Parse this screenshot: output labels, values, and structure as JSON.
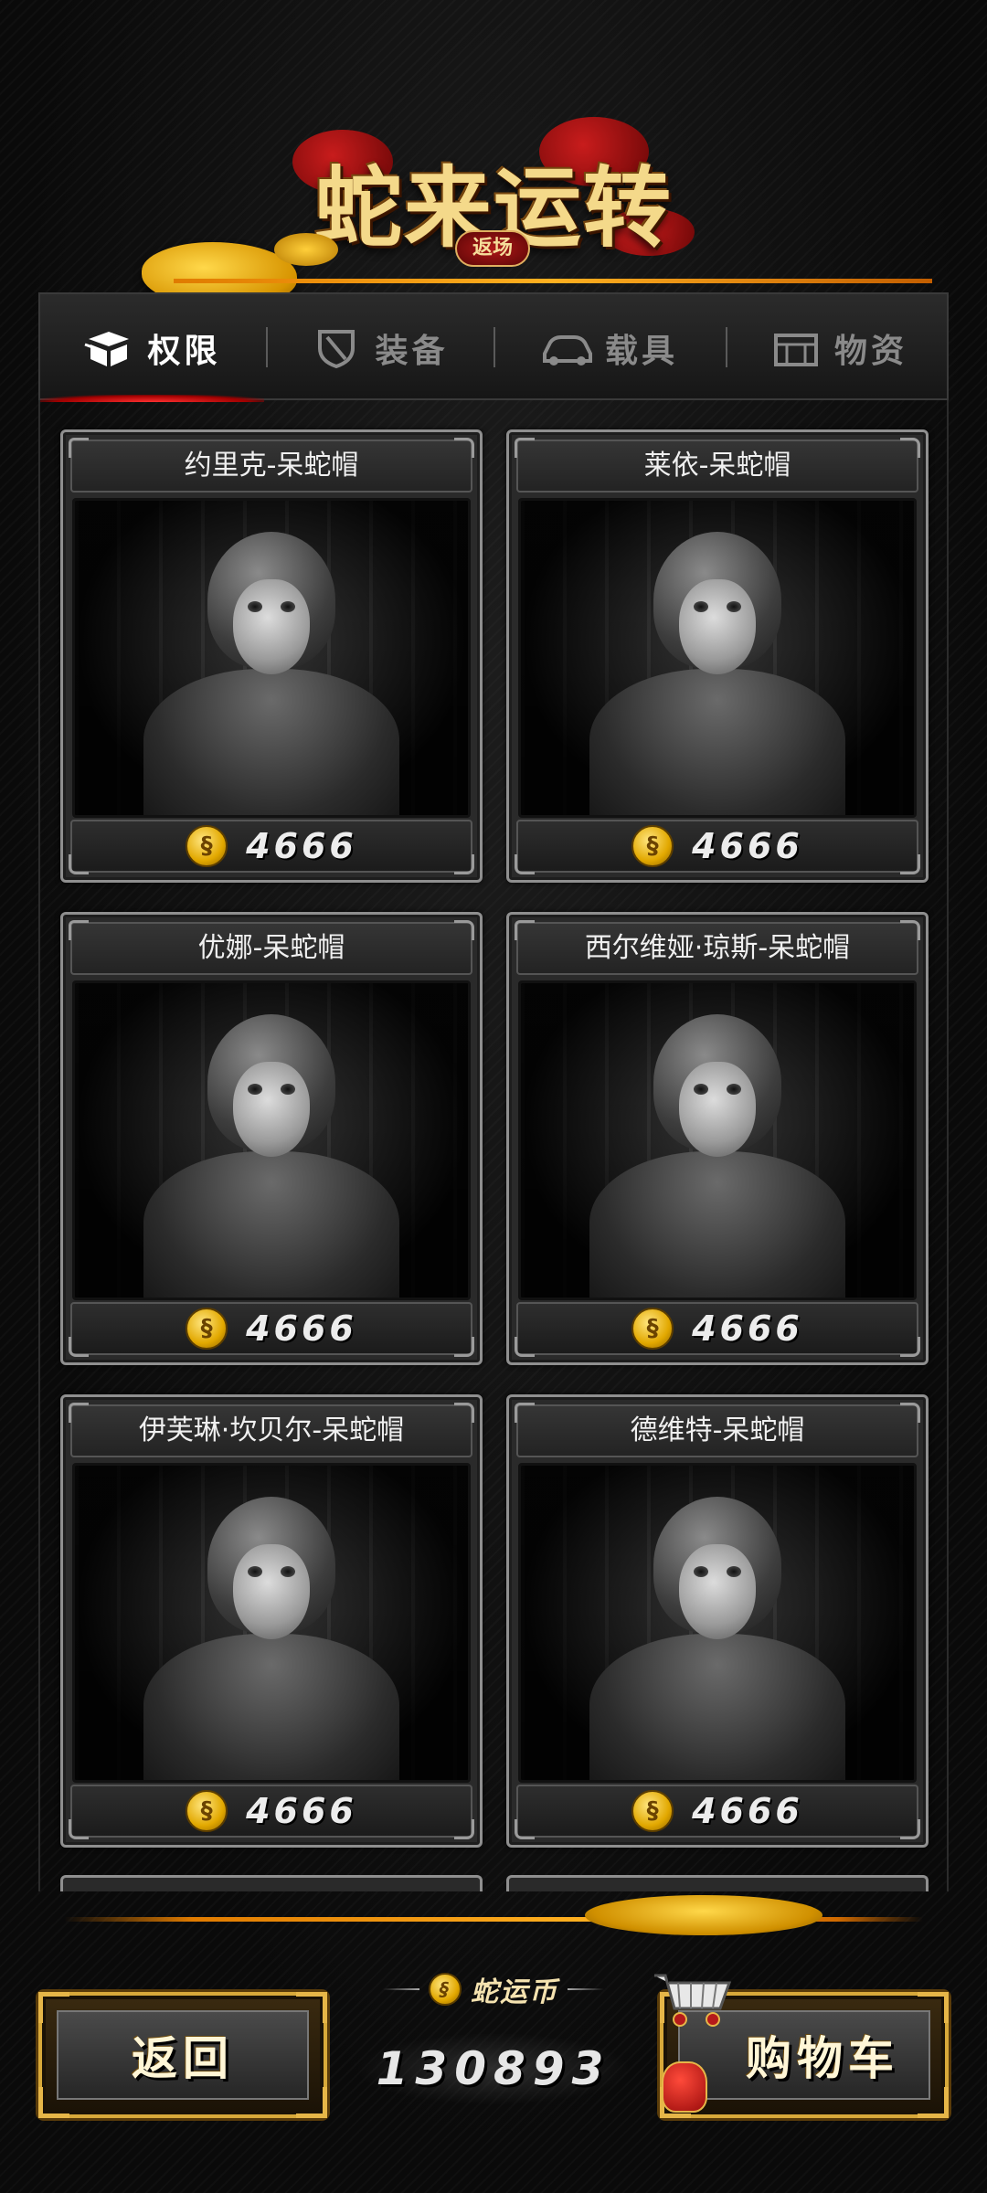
{
  "header": {
    "title": "蛇来运转",
    "subtitle": "返场"
  },
  "tabs": [
    {
      "label": "权限",
      "icon": "box-icon",
      "active": true
    },
    {
      "label": "装备",
      "icon": "shield-icon",
      "active": false
    },
    {
      "label": "载具",
      "icon": "car-icon",
      "active": false
    },
    {
      "label": "物资",
      "icon": "crate-icon",
      "active": false
    }
  ],
  "items": [
    {
      "name": "约里克-呆蛇帽",
      "price": "4666"
    },
    {
      "name": "莱依-呆蛇帽",
      "price": "4666"
    },
    {
      "name": "优娜-呆蛇帽",
      "price": "4666"
    },
    {
      "name": "西尔维娅·琼斯-呆蛇帽",
      "price": "4666"
    },
    {
      "name": "伊芙琳·坎贝尔-呆蛇帽",
      "price": "4666"
    },
    {
      "name": "德维特-呆蛇帽",
      "price": "4666"
    }
  ],
  "footer": {
    "back_label": "返回",
    "cart_label": "购物车",
    "currency_name": "蛇运币",
    "currency_amount": "130893"
  },
  "colors": {
    "accent_gold": "#f4d98a",
    "accent_orange": "#ffb020",
    "active_red": "#ff3030"
  }
}
